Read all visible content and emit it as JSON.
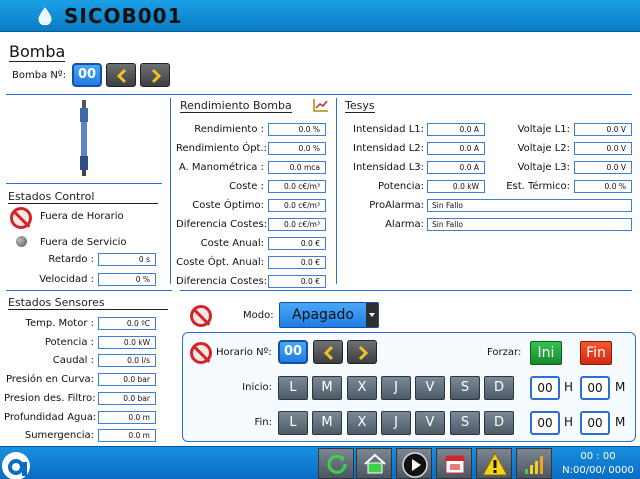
{
  "header": {
    "title": "SICOB001"
  },
  "bomba": {
    "title": "Bomba",
    "num_label": "Bomba Nº:",
    "num_value": "00"
  },
  "estados_control": {
    "title": "Estados Control",
    "fuera_horario": "Fuera de Horario",
    "fuera_servicio": "Fuera de Servicio",
    "retardo_label": "Retardo :",
    "retardo_value": "0 s",
    "velocidad_label": "Velocidad :",
    "velocidad_value": "0 %"
  },
  "estados_sensores": {
    "title": "Estados Sensores",
    "rows": [
      {
        "label": "Temp. Motor :",
        "value": "0.0 ºC"
      },
      {
        "label": "Potencia :",
        "value": "0.0 kW"
      },
      {
        "label": "Caudal :",
        "value": "0.0 l/s"
      },
      {
        "label": "Presión en Curva:",
        "value": "0.0 bar"
      },
      {
        "label": "Presion des. Filtro:",
        "value": "0.0 bar"
      },
      {
        "label": "Profundidad Agua:",
        "value": "0.0 m"
      },
      {
        "label": "Sumergencia:",
        "value": "0.0 m"
      }
    ]
  },
  "rendimiento": {
    "title": "Rendimiento Bomba",
    "rows": [
      {
        "label": "Rendimiento :",
        "value": "0.0 %"
      },
      {
        "label": "Rendimiento Ópt.:",
        "value": "0.0 %"
      },
      {
        "label": "A. Manométrica :",
        "value": "0.0 mca"
      },
      {
        "label": "Coste :",
        "value": "0.0 c€/m³"
      },
      {
        "label": "Coste Óptimo:",
        "value": "0.0 c€/m³"
      },
      {
        "label": "Diferencia Costes:",
        "value": "0.0 c€/m³"
      },
      {
        "label": "Coste Anual:",
        "value": "0.0 €"
      },
      {
        "label": "Coste Ópt. Anual:",
        "value": "0.0 €"
      },
      {
        "label": "Diferencia Costes:",
        "value": "0.0 €"
      }
    ]
  },
  "tesys": {
    "title": "Tesys",
    "intensidades": [
      {
        "label": "Intensidad L1:",
        "value": "0.0 A"
      },
      {
        "label": "Intensidad L2:",
        "value": "0.0 A"
      },
      {
        "label": "Intensidad L3:",
        "value": "0.0 A"
      },
      {
        "label": "Potencia:",
        "value": "0.0 kW"
      }
    ],
    "voltajes": [
      {
        "label": "Voltaje L1:",
        "value": "0.0 V"
      },
      {
        "label": "Voltaje L2:",
        "value": "0.0 V"
      },
      {
        "label": "Voltaje L3:",
        "value": "0.0 V"
      },
      {
        "label": "Est. Térmico:",
        "value": "0.0 %"
      }
    ],
    "proalarma_label": "ProAlarma:",
    "proalarma_value": "Sin Fallo",
    "alarma_label": "Alarma:",
    "alarma_value": "Sin Fallo"
  },
  "modo": {
    "label": "Modo:",
    "value": "Apagado"
  },
  "horario": {
    "label": "Horario Nº:",
    "value": "00",
    "forzar_label": "Forzar:",
    "ini_label": "Ini",
    "fin_label": "Fin",
    "inicio_label": "Inicio:",
    "fin_row_label": "Fin:",
    "days": [
      "L",
      "M",
      "X",
      "J",
      "V",
      "S",
      "D"
    ],
    "inicio_h": "00",
    "inicio_m": "00",
    "fin_h": "00",
    "fin_m": "00",
    "h_label": "H",
    "m_label": "M"
  },
  "footer": {
    "time": "00 : 00",
    "date": "N:00/00/ 0000"
  },
  "colors": {
    "header": "#0a7cc4",
    "accent": "#2b6fd6",
    "ini": "#1fa83a",
    "fin": "#e5381c"
  }
}
